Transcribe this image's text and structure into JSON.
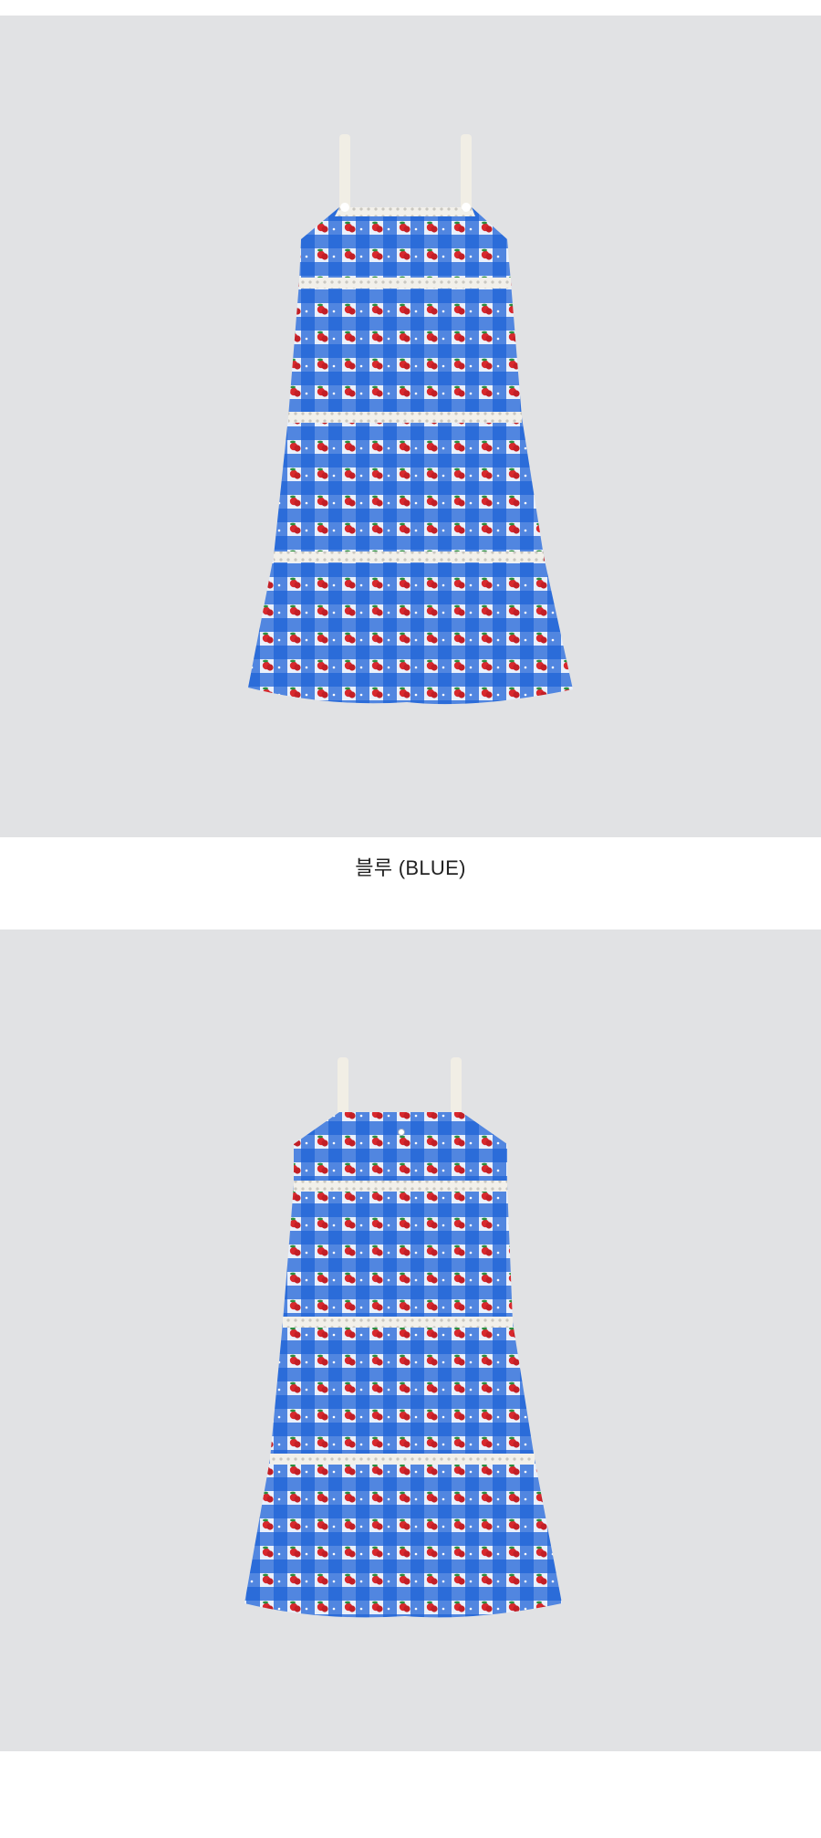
{
  "colors": {
    "background": "#ffffff",
    "photo_background": "#e1e2e4",
    "fabric_blue": "#1e63d6",
    "fabric_light": "#e9f0fb",
    "cherry_red": "#d8282d",
    "leaf_green": "#2a8f3f",
    "lace": "#f2f0ea",
    "caption_text": "#222222"
  },
  "product": {
    "color_label": "블루 (BLUE)",
    "views": [
      {
        "name": "front-view",
        "image": "dress-front-photo"
      },
      {
        "name": "back-view",
        "image": "dress-back-photo"
      }
    ]
  }
}
